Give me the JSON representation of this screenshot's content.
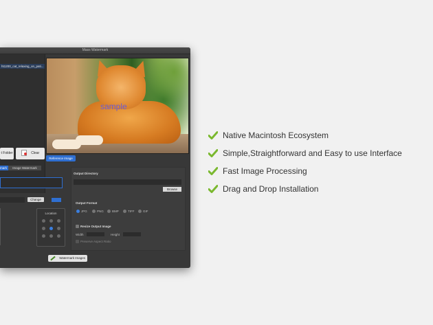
{
  "window": {
    "title": "Mass Watermark"
  },
  "file_list": {
    "item": "ht1200_cat_relaxing_on_pati..."
  },
  "left_buttons": {
    "folder_label": "t Folder",
    "clear_label": "Clear"
  },
  "preview": {
    "watermark_text": "sample"
  },
  "reference_button": "Reference Image",
  "tabs": [
    {
      "label": "mark"
    },
    {
      "label": "Image Watermark"
    }
  ],
  "change_button": "Change",
  "location": {
    "title": "Location",
    "selected_index": 4
  },
  "output": {
    "directory_label": "Output Directory",
    "browse_label": "Browse",
    "format_label": "Output Format",
    "formats": [
      "JPG",
      "PNG",
      "BMP",
      "TIFF",
      "GIF"
    ],
    "selected_format": "JPG",
    "resize_label": "Resize Output Image",
    "width_label": "Width",
    "height_label": "Height",
    "aspect_label": "Preserve Aspect Ratio"
  },
  "watermark_button": "Watermark Images",
  "features": [
    "Native Macintosh Ecosystem",
    "Simple,Straightforward and Easy to use Interface",
    "Fast Image Processing",
    "Drag and Drop Installation"
  ],
  "colors": {
    "accent": "#2f6fd1",
    "check": "#7ab82e",
    "window_bg": "#383838",
    "page_bg": "#f1f1f1"
  }
}
